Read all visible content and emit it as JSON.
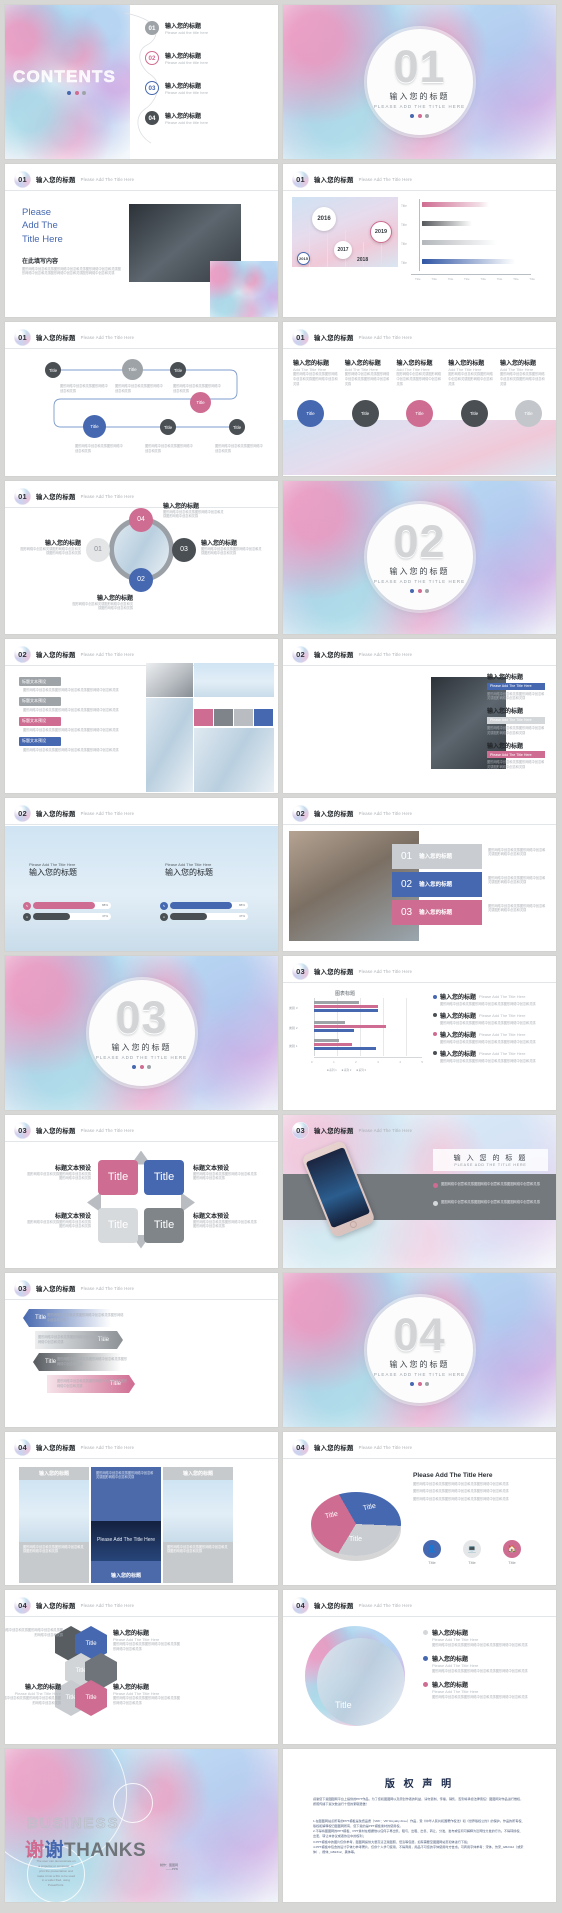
{
  "meta": {
    "kind": "powerpoint-template-preview-grid",
    "columns": 2,
    "slide_count": 26
  },
  "common": {
    "title_cn": "输入您的标题",
    "title_en": "Please Add The Title Here",
    "title_en_caps": "PLEASE ADD THE TITLE HERE",
    "title_en_short": "Please add the title here",
    "title_word": "Title",
    "body_cn": "图形网络中创意和灵感图形网络中创意和灵感图形网络中创意和灵感",
    "heading_preset_cn": "标题文本预设",
    "add_title_multiline": "Please Add The Title Here"
  },
  "colors": {
    "blue": "#4668b0",
    "pink": "#cf6c91",
    "gray": "#9ea3a8",
    "dark": "#4a4f54",
    "light_gray": "#c3c7cb",
    "page_bg": "#d7d7d5"
  },
  "slides": [
    {
      "id": "contents",
      "name": "contents-slide",
      "word": "CONTENTS",
      "items": [
        {
          "num": "01",
          "cn": "输入您的标题",
          "en": "Please add the title here",
          "style": "gray"
        },
        {
          "num": "02",
          "cn": "输入您的标题",
          "en": "Please add the title here",
          "style": "pink"
        },
        {
          "num": "03",
          "cn": "输入您的标题",
          "en": "Please add the title here",
          "style": "blue"
        },
        {
          "num": "04",
          "cn": "输入您的标题",
          "en": "Please add the title here",
          "style": "dark"
        }
      ]
    },
    {
      "id": "cover01",
      "name": "section-cover-01",
      "num": "01",
      "cn": "输入您的标题",
      "en": "PLEASE ADD THE TITLE HERE"
    },
    {
      "id": "s_intro",
      "name": "intro-slide",
      "badge": "01",
      "hdr_cn": "输入您的标题",
      "hdr_en": "Please Add The Title Here",
      "big_title": [
        "Please",
        "Add The",
        "Title Here"
      ],
      "sub_cn": "在此填写内容",
      "body": "图形网络中创意和灵感图形网络中创意和灵感图形网络中创意和灵感图形网络中创意和灵感图形网络中创意和灵感图形网络中创意和灵感"
    },
    {
      "id": "s_timeline_bar",
      "name": "timeline-bar-chart-slide",
      "badge": "01",
      "hdr_cn": "输入您的标题",
      "hdr_en": "Please Add The Title Here",
      "chart_data": {
        "type": "bar",
        "orientation": "horizontal",
        "title": "",
        "categories": [
          "Title",
          "Title",
          "Title",
          "Title"
        ],
        "values": [
          52,
          38,
          58,
          72
        ],
        "series_colors": [
          "#cf6c91",
          "#56595c",
          "#b3b7bb",
          "#2f55a4"
        ],
        "axis_ticks": [
          "Title",
          "Title",
          "Title",
          "Title",
          "Title",
          "Title",
          "Title",
          "Title"
        ],
        "ylim": [
          0,
          100
        ],
        "grid": false,
        "legend": "none"
      },
      "years": [
        "2015",
        "2016",
        "2017",
        "2018",
        "2019"
      ]
    },
    {
      "id": "s_flow",
      "name": "process-flow-slide",
      "badge": "01",
      "hdr_cn": "输入您的标题",
      "hdr_en": "Please Add The Title Here",
      "nodes": [
        {
          "label": "Title",
          "style": "dark"
        },
        {
          "label": "Title",
          "style": "gray"
        },
        {
          "label": "Title",
          "style": "dark"
        },
        {
          "label": "Title",
          "style": "pink"
        },
        {
          "label": "Title",
          "style": "blue"
        },
        {
          "label": "Title",
          "style": "dark"
        },
        {
          "label": "Title",
          "style": "dark"
        }
      ],
      "body": "图形网络中创意和灵感图形网络中创意和灵感"
    },
    {
      "id": "s_five_col",
      "name": "five-column-slide",
      "badge": "01",
      "hdr_cn": "输入您的标题",
      "hdr_en": "Please Add The Title Here",
      "columns": [
        {
          "cn": "输入您的标题",
          "en": "Add The Title Here",
          "circle": "Title",
          "style": "blue"
        },
        {
          "cn": "输入您的标题",
          "en": "Add The Title Here",
          "circle": "Title",
          "style": "dark"
        },
        {
          "cn": "输入您的标题",
          "en": "Add The Title Here",
          "circle": "Title",
          "style": "pink"
        },
        {
          "cn": "输入您的标题",
          "en": "Add The Title Here",
          "circle": "Title",
          "style": "dark"
        },
        {
          "cn": "输入您的标题",
          "en": "Add The Title Here",
          "circle": "Title",
          "style": "gray"
        }
      ]
    },
    {
      "id": "s_ring",
      "name": "circular-ring-slide",
      "badge": "01",
      "hdr_cn": "输入您的标题",
      "hdr_en": "Please Add The Title Here",
      "nodes": [
        {
          "num": "04",
          "cn": "输入您的标题",
          "style": "pink"
        },
        {
          "num": "01",
          "cn": "输入您的标题",
          "style": "light"
        },
        {
          "num": "03",
          "cn": "输入您的标题",
          "style": "dark"
        },
        {
          "num": "02",
          "cn": "输入您的标题",
          "style": "blue"
        }
      ],
      "body": "图形网络中创意和灵感图形网络中创意和灵感图形网络中创意和灵感"
    },
    {
      "id": "cover02",
      "name": "section-cover-02",
      "num": "02",
      "cn": "输入您的标题",
      "en": "PLEASE ADD THE TITLE HERE"
    },
    {
      "id": "s_mosaic",
      "name": "image-mosaic-slide",
      "badge": "02",
      "hdr_cn": "输入您的标题",
      "hdr_en": "Please Add The Title Here",
      "labels": [
        {
          "text": "标题文本预设",
          "style": "gray"
        },
        {
          "text": "标题文本预设",
          "style": "gray"
        },
        {
          "text": "标题文本预设",
          "style": "pink"
        },
        {
          "text": "标题文本预设",
          "style": "blue"
        }
      ],
      "swatches": [
        "#cf6c91",
        "#7e848a",
        "#b9bdc2",
        "#4668b0"
      ]
    },
    {
      "id": "s_devices",
      "name": "device-list-slide",
      "badge": "02",
      "hdr_cn": "输入您的标题",
      "hdr_en": "Please Add The Title Here",
      "items": [
        {
          "cn": "输入您的标题",
          "pill": "Please Add The Title Here",
          "style": "blue"
        },
        {
          "cn": "输入您的标题",
          "pill": "Please Add The Title Here",
          "style": "gray"
        },
        {
          "cn": "输入您的标题",
          "pill": "Please Add The Title Here",
          "style": "pink"
        }
      ]
    },
    {
      "id": "s_two_photo",
      "name": "two-photo-caption-slide",
      "badge": "02",
      "hdr_cn": "输入您的标题",
      "hdr_en": "Please Add The Title Here",
      "captions": [
        {
          "en": "Please Add The Title Here",
          "cn": "输入您的标题"
        },
        {
          "en": "Please Add The Title Here",
          "cn": "输入您的标题"
        }
      ],
      "progress": [
        {
          "label": "88%",
          "style": "pink"
        },
        {
          "label": "47%",
          "style": "dark"
        },
        {
          "label": "88%",
          "style": "blue"
        },
        {
          "label": "47%",
          "style": "dark"
        }
      ]
    },
    {
      "id": "s_numlist",
      "name": "numbered-list-photo-slide",
      "badge": "02",
      "hdr_cn": "输入您的标题",
      "hdr_en": "Please Add The Title Here",
      "rows": [
        {
          "num": "01",
          "cn": "输入您的标题",
          "style": "gray"
        },
        {
          "num": "02",
          "cn": "输入您的标题",
          "style": "blue"
        },
        {
          "num": "03",
          "cn": "输入您的标题",
          "style": "pink"
        }
      ],
      "body": "图形网络中创意和灵感图形网络中创意和灵感图形网络中创意和灵感"
    },
    {
      "id": "cover03",
      "name": "section-cover-03",
      "num": "03",
      "cn": "输入您的标题",
      "en": "PLEASE ADD THE TITLE HERE"
    },
    {
      "id": "s_groupbar",
      "name": "grouped-bar-chart-slide",
      "badge": "03",
      "hdr_cn": "输入您的标题",
      "hdr_en": "Please Add The Title Here",
      "chart_data": {
        "type": "bar",
        "orientation": "horizontal",
        "title": "图表标题",
        "categories": [
          "类别 3",
          "类别 2",
          "类别 1"
        ],
        "series": [
          {
            "name": "系列 1",
            "color": "#9ea3a8",
            "values": [
              4.4,
              2.4,
              1.8
            ]
          },
          {
            "name": "系列 2",
            "color": "#cf6c91",
            "values": [
              2.0,
              4.4,
              2.8
            ]
          },
          {
            "name": "系列 3",
            "color": "#4668b0",
            "values": [
              2.0,
              2.0,
              3.0
            ]
          }
        ],
        "xlim": [
          0,
          5
        ],
        "xticks": [
          0,
          1,
          2,
          3,
          4,
          5
        ],
        "legend": "bottom",
        "grid": true
      },
      "legend_items": [
        {
          "cn": "输入您的标题",
          "en": "Please Add The Title Here",
          "style": "blue"
        },
        {
          "cn": "输入您的标题",
          "en": "Please Add The Title Here",
          "style": "dark"
        },
        {
          "cn": "输入您的标题",
          "en": "Please Add The Title Here",
          "style": "pink"
        },
        {
          "cn": "输入您的标题",
          "en": "Please Add The Title Here",
          "style": "dark"
        }
      ]
    },
    {
      "id": "s_quad",
      "name": "quadrant-slide",
      "badge": "03",
      "hdr_cn": "输入您的标题",
      "hdr_en": "Please Add The Title Here",
      "tiles": [
        {
          "label": "Title",
          "style": "pink"
        },
        {
          "label": "Title",
          "style": "blue"
        },
        {
          "label": "Title",
          "style": "light"
        },
        {
          "label": "Title",
          "style": "dark"
        }
      ],
      "side_labels": [
        "标题文本预设",
        "标题文本预设",
        "标题文本预设",
        "标题文本预设"
      ]
    },
    {
      "id": "s_phone",
      "name": "phone-banner-slide",
      "badge": "03",
      "hdr_cn": "输入您的标题",
      "hdr_en": "Please Add The Title Here",
      "banner_cn": "输 入 您 的 标 题",
      "banner_en": "PLEASE ADD THE TITLE HERE",
      "bullets": [
        {
          "text": "图图网络中创意和灵感图图网络中创意和灵感图图网络中创意和灵感",
          "style": "pink"
        },
        {
          "text": "图图网络中创意和灵感图图网络中创意和灵感图图网络中创意和灵感",
          "style": "light"
        }
      ]
    },
    {
      "id": "s_arrows",
      "name": "arrow-bands-slide",
      "badge": "03",
      "hdr_cn": "输入您的标题",
      "hdr_en": "Please Add The Title Here",
      "bands": [
        {
          "label": "Title",
          "dir": "left",
          "style": "blue"
        },
        {
          "label": "Title",
          "dir": "right",
          "style": "light"
        },
        {
          "label": "Title",
          "dir": "left",
          "style": "dark"
        },
        {
          "label": "Title",
          "dir": "right",
          "style": "pink"
        }
      ],
      "body": "图形网络中创意和灵感图形网络中创意和灵感图形网络中创意和灵感"
    },
    {
      "id": "cover04",
      "name": "section-cover-04",
      "num": "04",
      "cn": "输入您的标题",
      "en": "PLEASE ADD THE TITLE HERE"
    },
    {
      "id": "s_threecol",
      "name": "three-column-image-slide",
      "badge": "04",
      "hdr_cn": "输入您的标题",
      "hdr_en": "Please Add The Title Here",
      "cols": [
        {
          "cap": "输入您的标题",
          "style": "gray"
        },
        {
          "cap": "输入您的标题",
          "style": "blue",
          "overlay": "Please Add The Title Here"
        },
        {
          "cap": "输入您的标题",
          "style": "gray"
        }
      ]
    },
    {
      "id": "s_pie",
      "name": "pie-chart-slide",
      "badge": "04",
      "hdr_cn": "输入您的标题",
      "hdr_en": "Please Add The Title Here",
      "heading_en": "Please Add The Title Here",
      "chart_data": {
        "type": "pie",
        "title": "",
        "labels": [
          "Title",
          "Title",
          "Title"
        ],
        "values": [
          34,
          33,
          33
        ],
        "colors": [
          "#4668b0",
          "#c9cdd1",
          "#cf6c91"
        ]
      },
      "icons": [
        {
          "name": "user-icon",
          "label": "Title",
          "style": "blue"
        },
        {
          "name": "monitor-icon",
          "label": "Title",
          "style": "light"
        },
        {
          "name": "home-icon",
          "label": "Title",
          "style": "pink"
        }
      ],
      "body": "图形网络中创意和灵感图形网络中创意和灵感图形网络中创意和灵感"
    },
    {
      "id": "s_hex",
      "name": "hexagon-cluster-slide",
      "badge": "04",
      "hdr_cn": "输入您的标题",
      "hdr_en": "Please Add The Title Here",
      "hexes": [
        {
          "label": "",
          "style": "dark"
        },
        {
          "label": "Title",
          "style": "blue"
        },
        {
          "label": "Title",
          "style": "light"
        },
        {
          "label": "",
          "style": "dark"
        },
        {
          "label": "Title",
          "style": "gray"
        },
        {
          "label": "Title",
          "style": "pink"
        }
      ],
      "texts": [
        {
          "cn": "输入您的标题",
          "en": "Please Add The Title Here"
        },
        {
          "cn": "输入您的标题",
          "en": "Please Add The Title Here"
        },
        {
          "cn": "输入您的标题",
          "en": "Please Add The Title Here"
        },
        {
          "cn": "输入您的标题",
          "en": "Please Add The Title Here"
        }
      ]
    },
    {
      "id": "s_circleimg",
      "name": "circle-image-list-slide",
      "badge": "04",
      "hdr_cn": "输入您的标题",
      "hdr_en": "Please Add The Title Here",
      "circle_label": "Title",
      "items": [
        {
          "cn": "输入您的标题",
          "en": "Please Add The Title Here",
          "style": "light"
        },
        {
          "cn": "输入您的标题",
          "en": "Please Add The Title Here",
          "style": "blue"
        },
        {
          "cn": "输入您的标题",
          "en": "Please Add The Title Here",
          "style": "pink"
        }
      ]
    },
    {
      "id": "s_thanks",
      "name": "thanks-slide",
      "business": "BUSINESS",
      "thanks_cn": "谢谢",
      "thanks_en": "THANKS",
      "note": "The user can demonstrate on a projector or computer, or print the presentation and make it into a film to be used in a wider filed, using PowerPoint.",
      "corner": "制作：图图网\n——PPD"
    },
    {
      "id": "s_copyright",
      "name": "copyright-slide",
      "title": "版 权 声 明",
      "intro": "感谢您下载图图网平台上提供的PPT作品，为了您和图图网以及原创作者的利益，请勿复制、传播、销售，否则将承担法律责任！图图网对作品进行维权，按照传播下载次数进行十倍的索取赔偿！",
      "paragraphs": [
        "1.在图图网站点所有的PPT模板是免费品质（VRF：VIP Royalty-Free）作品，受《中华人民共和国著作权法》和《世界版权公约》的保护。作品的所有权、版权和解释权归图图网所有，您下载的是PPT模板素材的使用权。",
        "2.不得将图图网的PPT模板、PPT素材在根据他以任何子再出售、租与、出租、出售、转让、分发、发布或任何可解释为近同性分发的行为。不得转授权、出麦、转让本协议或者协议中的权利；",
        "3.PPT模板中的图片仅供参考，图图网提供大量高清正版图照、低清等包层，如有需要至图图网站页和体进行下载；",
        "4.PPT模板中包含的设计字体力参考著片，仅供个人学习使用，不得商用，用品不可您的字体使用时方告虑。可商用字体参考：宋体、仿宋_GB2312（或宋体），楷体_GB2312、黑体等。"
      ]
    }
  ]
}
